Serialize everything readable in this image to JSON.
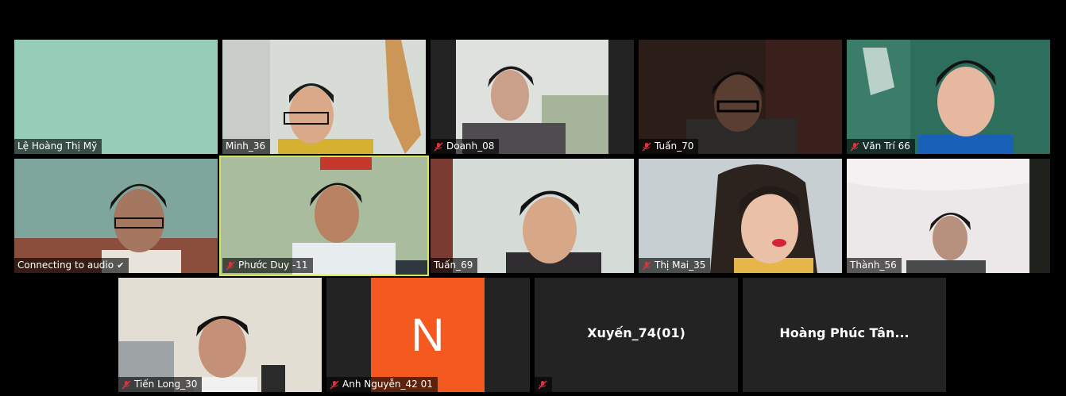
{
  "colors": {
    "background": "#000000",
    "tile_empty": "#232323",
    "active_speaker": "#d6e85a",
    "avatar": "#f45a1f",
    "muted_icon": "#e0313d"
  },
  "participants": [
    {
      "name": "Lệ Hoàng Thị Mỹ",
      "muted": false,
      "video": true
    },
    {
      "name": "Minh_36",
      "muted": false,
      "video": true
    },
    {
      "name": "Doanh_08",
      "muted": true,
      "video": true
    },
    {
      "name": "Tuấn_70",
      "muted": true,
      "video": true
    },
    {
      "name": "Văn Trí 66",
      "muted": true,
      "video": true
    },
    {
      "name": "Connecting to audio",
      "muted": false,
      "video": true
    },
    {
      "name": "Phước Duy -11",
      "muted": true,
      "video": true,
      "active_speaker": true
    },
    {
      "name": "Tuấn_69",
      "muted": false,
      "video": true
    },
    {
      "name": "Thị Mai_35",
      "muted": true,
      "video": true
    },
    {
      "name": "Thành_56",
      "muted": false,
      "video": true
    },
    {
      "name": "Tiến Long_30",
      "muted": true,
      "video": true
    },
    {
      "name": "Anh Nguyễn_42 01",
      "muted": true,
      "video": false,
      "avatar_letter": "N"
    },
    {
      "name": "Xuyến_74(01)",
      "muted": true,
      "video": false
    },
    {
      "name": "Hoàng Phúc Tân...",
      "muted": false,
      "video": false
    }
  ]
}
